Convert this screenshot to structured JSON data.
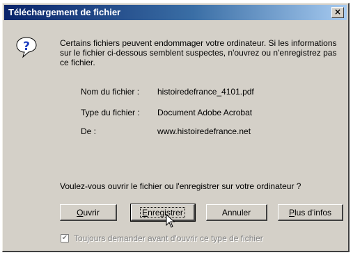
{
  "window": {
    "title": "Téléchargement de fichier",
    "close_label": "×"
  },
  "message": "Certains fichiers peuvent endommager votre ordinateur. Si les informations sur le fichier ci-dessous semblent suspectes, n'ouvrez ou n'enregistrez pas ce fichier.",
  "file_info": {
    "name_label": "Nom du fichier :",
    "name_value": "histoiredefrance_4101.pdf",
    "type_label": "Type du fichier :",
    "type_value": "Document Adobe Acrobat",
    "from_label": "De :",
    "from_value": "www.histoiredefrance.net"
  },
  "question": "Voulez-vous ouvrir le fichier ou l'enregistrer sur votre ordinateur ?",
  "buttons": {
    "open": {
      "mnemonic": "O",
      "rest": "uvrir"
    },
    "save": {
      "mnemonic": "E",
      "rest": "nregistrer"
    },
    "cancel": "Annuler",
    "more_info": {
      "mnemonic": "P",
      "rest": "lus d'infos"
    }
  },
  "checkbox": {
    "checked": true,
    "label": "Toujours demander avant d'ouvrir ce type de fichier"
  },
  "icons": {
    "question": "question-icon",
    "cursor": "mouse-cursor-icon"
  },
  "colors": {
    "title_bar_start": "#0a246a",
    "title_bar_end": "#a6caf0",
    "dialog_bg": "#d4d0c8"
  }
}
